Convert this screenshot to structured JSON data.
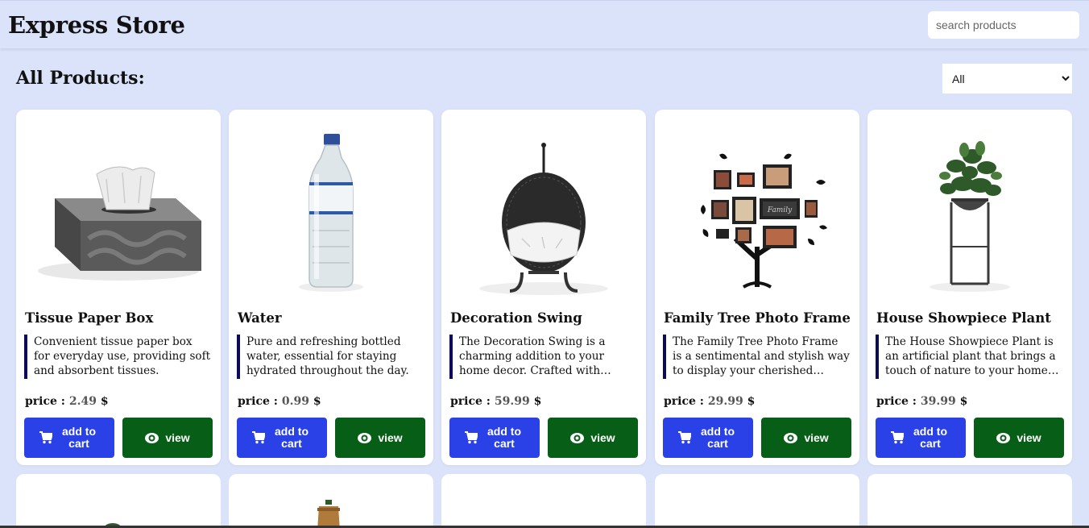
{
  "header": {
    "brand": "Express Store",
    "search_placeholder": "search products"
  },
  "main": {
    "section_title": "All Products:",
    "filter": {
      "selected": "All",
      "options": [
        "All"
      ]
    }
  },
  "products": [
    {
      "name": "Tissue Paper Box",
      "description": "Convenient tissue paper box for everyday use, providing soft and absorbent tissues.",
      "price_label": "price :",
      "price": "2.49",
      "currency": "$",
      "add_label": "add to cart",
      "view_label": "view"
    },
    {
      "name": "Water",
      "description": "Pure and refreshing bottled water, essential for staying hydrated throughout the day.",
      "price_label": "price :",
      "price": "0.99",
      "currency": "$",
      "add_label": "add to cart",
      "view_label": "view"
    },
    {
      "name": "Decoration Swing",
      "description": "The Decoration Swing is a charming addition to your home decor. Crafted with intricate…",
      "price_label": "price :",
      "price": "59.99",
      "currency": "$",
      "add_label": "add to cart",
      "view_label": "view"
    },
    {
      "name": "Family Tree Photo Frame",
      "description": "The Family Tree Photo Frame is a sentimental and stylish way to display your cherished family…",
      "price_label": "price :",
      "price": "29.99",
      "currency": "$",
      "add_label": "add to cart",
      "view_label": "view"
    },
    {
      "name": "House Showpiece Plant",
      "description": "The House Showpiece Plant is an artificial plant that brings a touch of nature to your home without…",
      "price_label": "price :",
      "price": "39.99",
      "currency": "$",
      "add_label": "add to cart",
      "view_label": "view"
    }
  ],
  "icons": {
    "cart": "cart-icon",
    "view": "eye-icon"
  },
  "colors": {
    "background": "#dbe3fa",
    "add_button": "#2a41e8",
    "view_button": "#075e16",
    "description_bar": "#0b0b5a"
  }
}
